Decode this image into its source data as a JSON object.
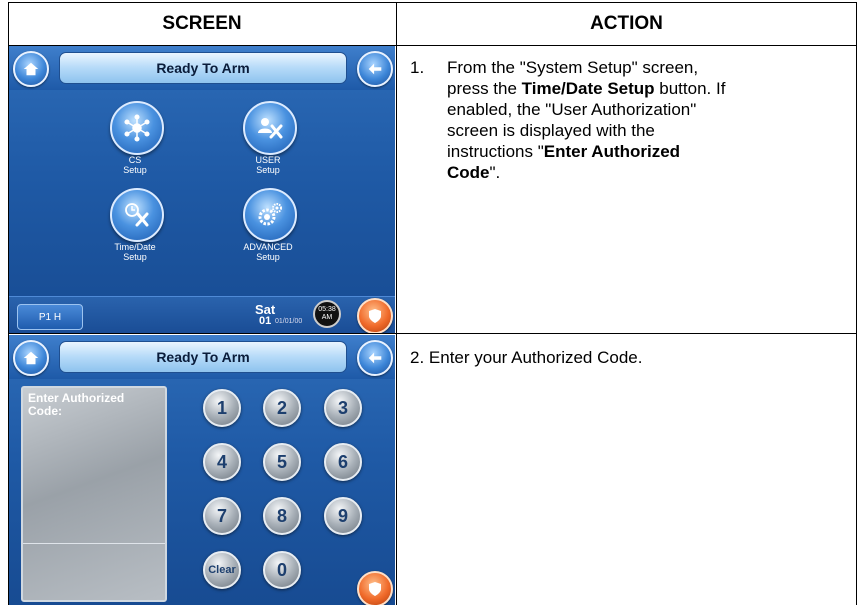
{
  "headers": {
    "screen": "SCREEN",
    "action": "ACTION"
  },
  "screen1": {
    "status": "Ready To Arm",
    "buttons": [
      {
        "label_line1": "CS",
        "label_line2": "Setup",
        "icon": "network-icon"
      },
      {
        "label_line1": "USER",
        "label_line2": "Setup",
        "icon": "user-tools-icon"
      },
      {
        "label_line1": "Time/Date",
        "label_line2": "Setup",
        "icon": "clock-tools-icon"
      },
      {
        "label_line1": "ADVANCED",
        "label_line2": "Setup",
        "icon": "gears-icon"
      }
    ],
    "partition": "P1 H",
    "day": "Sat",
    "day_num": "01",
    "date": "01/01/00",
    "time": "05:38",
    "ampm": "AM"
  },
  "screen2": {
    "status": "Ready To Arm",
    "entry_label_line1": "Enter Authorized",
    "entry_label_line2": "Code:",
    "keys": [
      "1",
      "2",
      "3",
      "4",
      "5",
      "6",
      "7",
      "8",
      "9",
      "Clear",
      "0"
    ]
  },
  "step1": {
    "number": "1.",
    "line1": "From the \"System Setup\" screen,",
    "line2_pre": "press the ",
    "line2_bold": "Time/Date Setup",
    "line2_post": " button. If",
    "line3": "enabled, the \"User Authorization\"",
    "line4": "screen is displayed with the",
    "line5_pre": "instructions \"",
    "line5_bold": "Enter Authorized",
    "line6_bold": "Code",
    "line6_post": "\"."
  },
  "step2": {
    "text": "2. Enter your Authorized Code."
  },
  "colors": {
    "screen_blue": "#1f5aa6",
    "title_pill": "#b5daf8",
    "shield_orange": "#f06a2a"
  }
}
